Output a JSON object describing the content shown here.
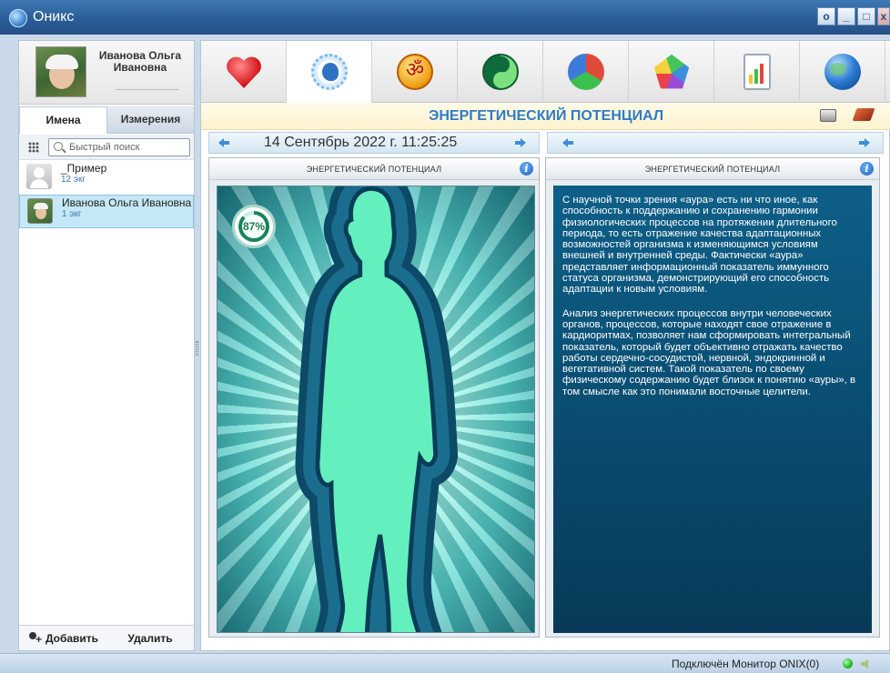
{
  "app": {
    "title": "Оникс",
    "window_buttons": [
      "o",
      "_",
      "□",
      "x"
    ]
  },
  "profile": {
    "name": "Иванова Ольга Ивановна"
  },
  "left_tabs": [
    {
      "label": "Имена",
      "active": true
    },
    {
      "label": "Измерения",
      "active": false
    }
  ],
  "search": {
    "placeholder": "Быстрый поиск"
  },
  "patients": [
    {
      "name": "_Пример",
      "sub": "12 экг",
      "selected": false
    },
    {
      "name": "Иванова Ольга Ивановна",
      "sub": "1 экг",
      "selected": true
    }
  ],
  "left_footer": {
    "add_label": "Добавить",
    "delete_label": "Удалить"
  },
  "module_tabs": [
    {
      "icon": "heart-ecg-icon",
      "active": false
    },
    {
      "icon": "head-profile-icon",
      "active": true
    },
    {
      "icon": "om-symbol-icon",
      "active": false
    },
    {
      "icon": "yin-yang-icon",
      "active": false
    },
    {
      "icon": "color-cube-icon",
      "active": false
    },
    {
      "icon": "pentagon-chart-icon",
      "active": false
    },
    {
      "icon": "bar-chart-icon",
      "active": false
    },
    {
      "icon": "globe-icon",
      "active": false
    }
  ],
  "header": {
    "title": "ЭНЕРГЕТИЧЕСКИЙ ПОТЕНЦИАЛ",
    "color": "#2e7bc7"
  },
  "nav": {
    "date": "14 Сентябрь 2022 г. 11:25:25"
  },
  "left_panel": {
    "title": "ЭНЕРГЕТИЧЕСКИЙ ПОТЕНЦИАЛ",
    "percent_label": "87%",
    "percent": 87
  },
  "right_panel": {
    "title": "ЭНЕРГЕТИЧЕСКИЙ ПОТЕНЦИАЛ",
    "paragraphs": [
      "С научной точки зрения «аура» есть ни что иное, как способность к поддержанию и сохранению гармонии физиологических процессов на протяжении длительного периода, то есть отражение качества адаптационных возможностей организма к изменяющимся условиям внешней и внутренней среды. Фактически «аура» представляет информационный показатель иммунного статуса организма, демонстрирующий его способность адаптации к новым условиям.",
      "Анализ энергетических процессов внутри человеческих органов, процессов, которые находят свое отражение в кардиоритмах, позволяет нам сформировать интегральный показатель, который будет объективно отражать качество работы сердечно-сосудистой, нервной, эндокринной и вегетативной систем. Такой показатель по своему физическому содержанию будет близок к понятию «ауры», в том смысле как это понимали восточные целители."
    ]
  },
  "status": {
    "text": "Подключён Монитор ONIX(0)",
    "indicator_color": "#19b321"
  }
}
